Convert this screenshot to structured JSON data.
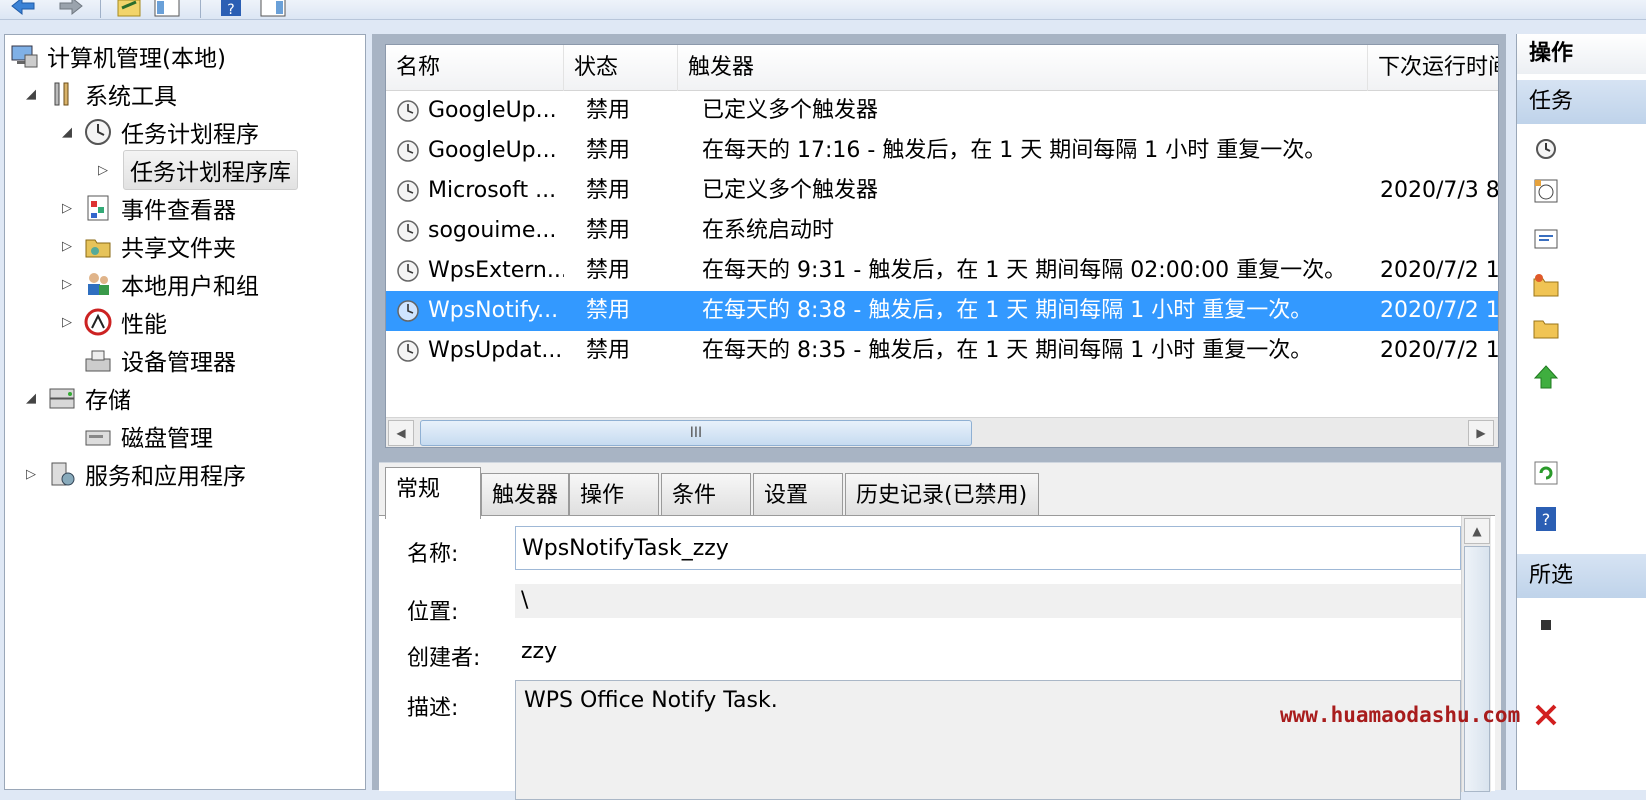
{
  "tree": {
    "items": [
      {
        "label": "计算机管理(本地)",
        "expander": "",
        "icon": "computer-management-icon"
      },
      {
        "label": "系统工具",
        "expander": "◢",
        "icon": "system-tools-icon"
      },
      {
        "label": "任务计划程序",
        "expander": "◢",
        "icon": "task-scheduler-icon"
      },
      {
        "label": "任务计划程序库",
        "expander": "▷",
        "icon": ""
      },
      {
        "label": "事件查看器",
        "expander": "▷",
        "icon": "event-viewer-icon"
      },
      {
        "label": "共享文件夹",
        "expander": "▷",
        "icon": "shared-folders-icon"
      },
      {
        "label": "本地用户和组",
        "expander": "▷",
        "icon": "local-users-icon"
      },
      {
        "label": "性能",
        "expander": "▷",
        "icon": "performance-icon"
      },
      {
        "label": "设备管理器",
        "expander": "",
        "icon": "device-manager-icon"
      },
      {
        "label": "存储",
        "expander": "◢",
        "icon": "storage-icon"
      },
      {
        "label": "磁盘管理",
        "expander": "",
        "icon": "disk-management-icon"
      },
      {
        "label": "服务和应用程序",
        "expander": "▷",
        "icon": "services-apps-icon"
      }
    ]
  },
  "task_list": {
    "columns": [
      "名称",
      "状态",
      "触发器",
      "下次运行时间"
    ],
    "rows": [
      {
        "name": "GoogleUp...",
        "status": "禁用",
        "trigger": "已定义多个触发器",
        "next": ""
      },
      {
        "name": "GoogleUp...",
        "status": "禁用",
        "trigger": "在每天的 17:16 - 触发后，在 1 天 期间每隔 1 小时 重复一次。",
        "next": ""
      },
      {
        "name": "Microsoft ...",
        "status": "禁用",
        "trigger": "已定义多个触发器",
        "next": "2020/7/3 8"
      },
      {
        "name": "sogouime...",
        "status": "禁用",
        "trigger": "在系统启动时",
        "next": ""
      },
      {
        "name": "WpsExtern...",
        "status": "禁用",
        "trigger": "在每天的 9:31 - 触发后，在 1 天 期间每隔 02:00:00 重复一次。",
        "next": "2020/7/2 1"
      },
      {
        "name": "WpsNotify...",
        "status": "禁用",
        "trigger": "在每天的 8:38 - 触发后，在 1 天 期间每隔 1 小时 重复一次。",
        "next": "2020/7/2 1",
        "selected": true
      },
      {
        "name": "WpsUpdat...",
        "status": "禁用",
        "trigger": "在每天的 8:35 - 触发后，在 1 天 期间每隔 1 小时 重复一次。",
        "next": "2020/7/2 1"
      }
    ],
    "scroll_thumb_grip": "III"
  },
  "details": {
    "tabs": [
      "常规",
      "触发器",
      "操作",
      "条件",
      "设置",
      "历史记录(已禁用)"
    ],
    "active_tab": "常规",
    "fields": {
      "name_label": "名称:",
      "name_value": "WpsNotifyTask_zzy",
      "location_label": "位置:",
      "location_value": "\\",
      "author_label": "创建者:",
      "author_value": "zzy",
      "description_label": "描述:",
      "description_value": "WPS Office Notify Task."
    }
  },
  "actions_pane": {
    "header": "操作",
    "section1": "任务",
    "section2": "所选",
    "icons": [
      "clock-icon",
      "create-task-icon",
      "import-task-icon",
      "new-folder-icon",
      "folder-icon",
      "up-arrow-icon",
      "refresh-icon",
      "help-icon",
      "stop-icon",
      "delete-icon"
    ]
  },
  "watermark": "www.huamaodashu.com",
  "colors": {
    "selection": "#3399ff",
    "pane_border": "#9aa7b8",
    "watermark": "#a81c1c"
  }
}
